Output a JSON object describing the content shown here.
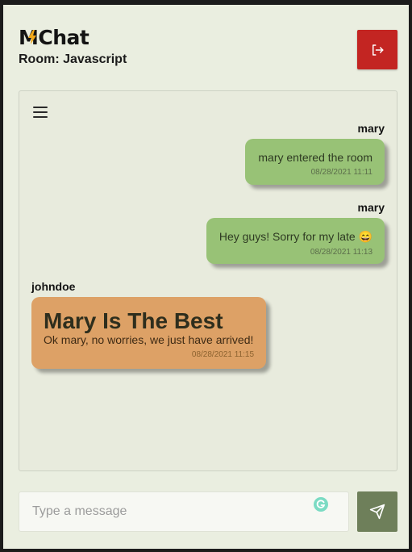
{
  "header": {
    "logo_text": "MChat",
    "logo_left": "M",
    "logo_right": "Chat",
    "room_label": "Room: Javascript"
  },
  "icons": {
    "logout": "logout-icon",
    "menu": "hamburger-menu-icon",
    "send": "send-icon",
    "grammarly": "grammarly-icon"
  },
  "messages": [
    {
      "sender": "mary",
      "text": "mary entered the room",
      "time": "08/28/2021 11:11",
      "own": true
    },
    {
      "sender": "mary",
      "text": "Hey guys! Sorry for my late 😄",
      "time": "08/28/2021 11:13",
      "own": true
    },
    {
      "sender": "johndoe",
      "headline": "Mary Is The Best",
      "text": "Ok mary, no worries, we just have arrived!",
      "time": "08/28/2021 11:15",
      "own": false
    }
  ],
  "composer": {
    "placeholder": "Type a message",
    "value": ""
  },
  "colors": {
    "logout": "#c32522",
    "send": "#6e7f5a",
    "own_bubble": "#98c276",
    "other_bubble": "#dda166",
    "logo_bolt": "#f0a81a"
  }
}
